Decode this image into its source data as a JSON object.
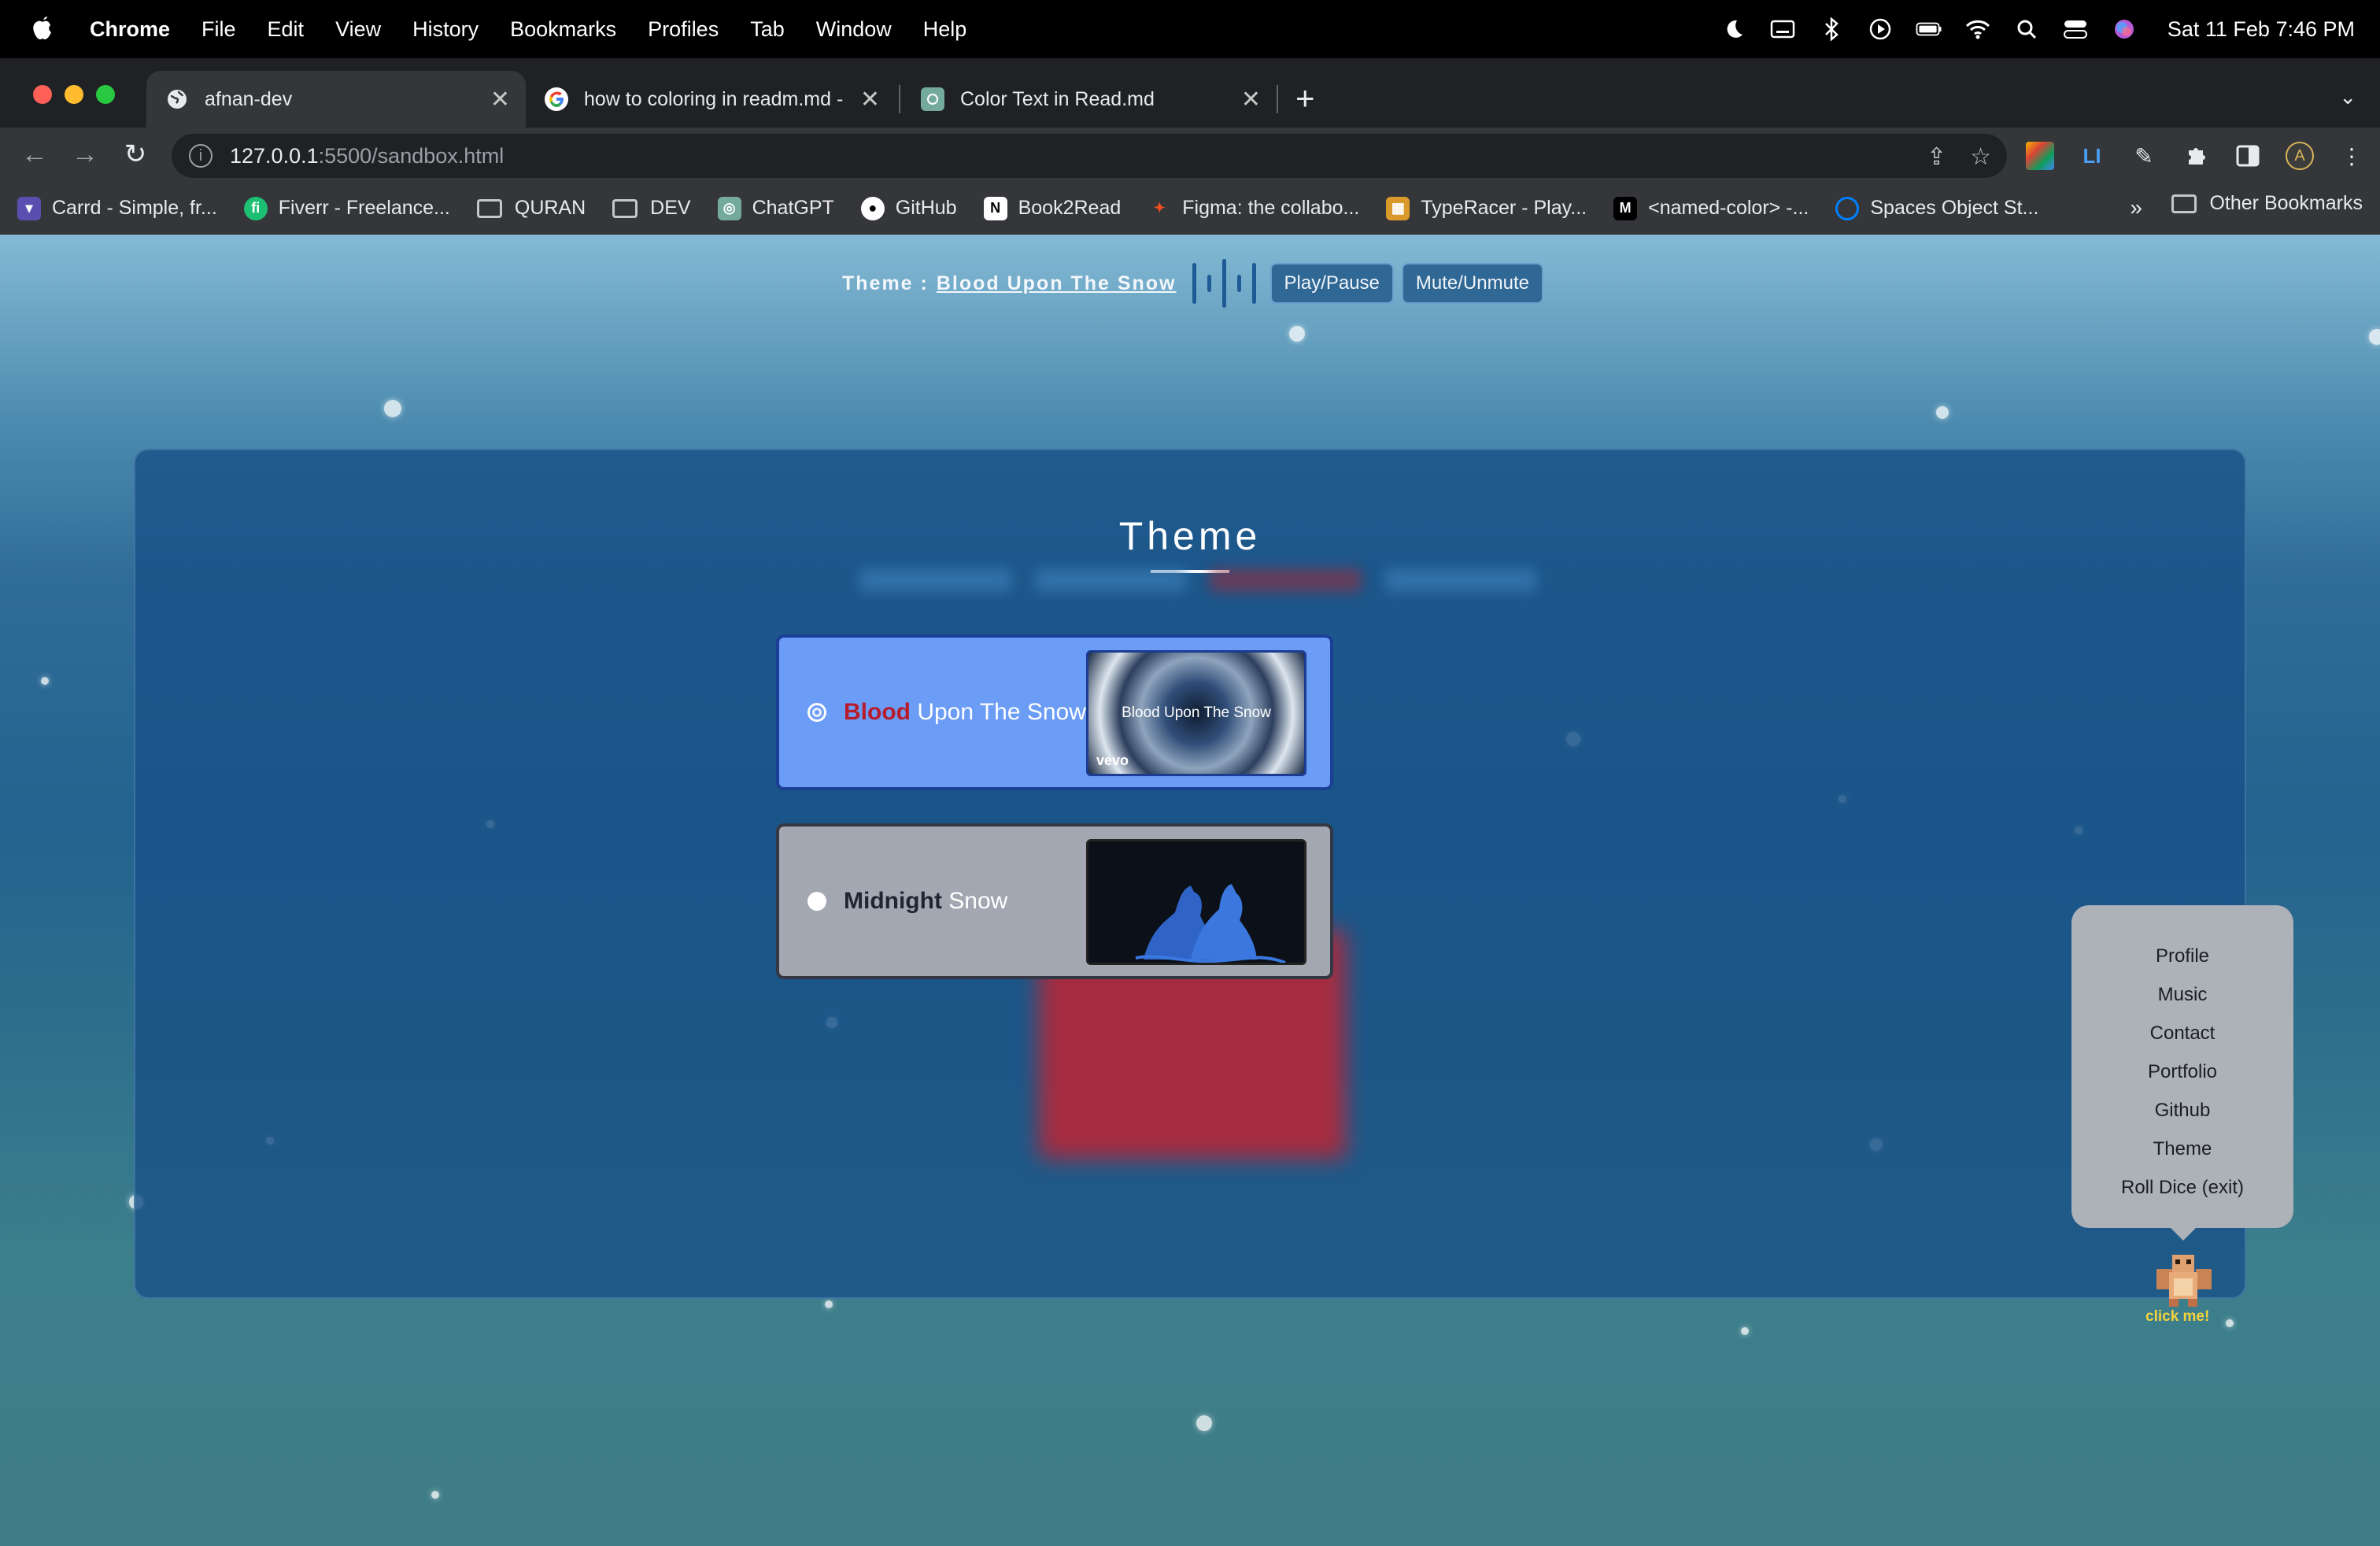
{
  "menubar": {
    "app": "Chrome",
    "items": [
      "File",
      "Edit",
      "View",
      "History",
      "Bookmarks",
      "Profiles",
      "Tab",
      "Window",
      "Help"
    ],
    "clock": "Sat 11 Feb  7:46 PM"
  },
  "browser": {
    "tabs": [
      {
        "title": "afnan-dev",
        "icon": "globe-icon"
      },
      {
        "title": "how to coloring in readm.md -",
        "icon": "google-icon"
      },
      {
        "title": "Color Text in Read.md",
        "icon": "chatgpt-icon"
      }
    ],
    "url_host": "127.0.0.1",
    "url_path": ":5500/sandbox.html",
    "bookmarks": [
      {
        "label": "Carrd - Simple, fr...",
        "icon": "carrd-icon",
        "color": "#5a4fb0"
      },
      {
        "label": "Fiverr - Freelance...",
        "icon": "fiverr-icon",
        "color": "#1dbf73"
      },
      {
        "label": "QURAN",
        "icon": "folder-icon",
        "color": ""
      },
      {
        "label": "DEV",
        "icon": "folder-icon",
        "color": ""
      },
      {
        "label": "ChatGPT",
        "icon": "chatgpt-icon",
        "color": "#74aa9c"
      },
      {
        "label": "GitHub",
        "icon": "github-icon",
        "color": "#ffffff"
      },
      {
        "label": "Book2Read",
        "icon": "notion-icon",
        "color": "#ffffff"
      },
      {
        "label": "Figma: the collabo...",
        "icon": "figma-icon",
        "color": "#f24e1e"
      },
      {
        "label": "TypeRacer - Play...",
        "icon": "typeracer-icon",
        "color": "#d99a2b"
      },
      {
        "label": "<named-color> -...",
        "icon": "mdn-icon",
        "color": "#ffffff"
      },
      {
        "label": "Spaces Object St...",
        "icon": "digitalocean-icon",
        "color": "#0080ff"
      }
    ],
    "bookmarks_more": "»",
    "other_bookmarks": "Other Bookmarks"
  },
  "page": {
    "theme_label": "Theme :",
    "theme_name": "Blood Upon The Snow",
    "play_pause": "Play/Pause",
    "mute_unmute": "Mute/Unmute",
    "panel_title": "Theme",
    "options": [
      {
        "accent": "Blood",
        "rest": " Upon The Snow",
        "selected": true,
        "thumb_text": "Blood Upon The Snow",
        "thumb_badge": "vevo"
      },
      {
        "accent": "Midnight",
        "rest": " Snow",
        "selected": false
      }
    ],
    "side_menu": [
      "Profile",
      "Music",
      "Contact",
      "Portfolio",
      "Github",
      "Theme",
      "Roll Dice (exit)"
    ],
    "click_me": "click me!"
  }
}
